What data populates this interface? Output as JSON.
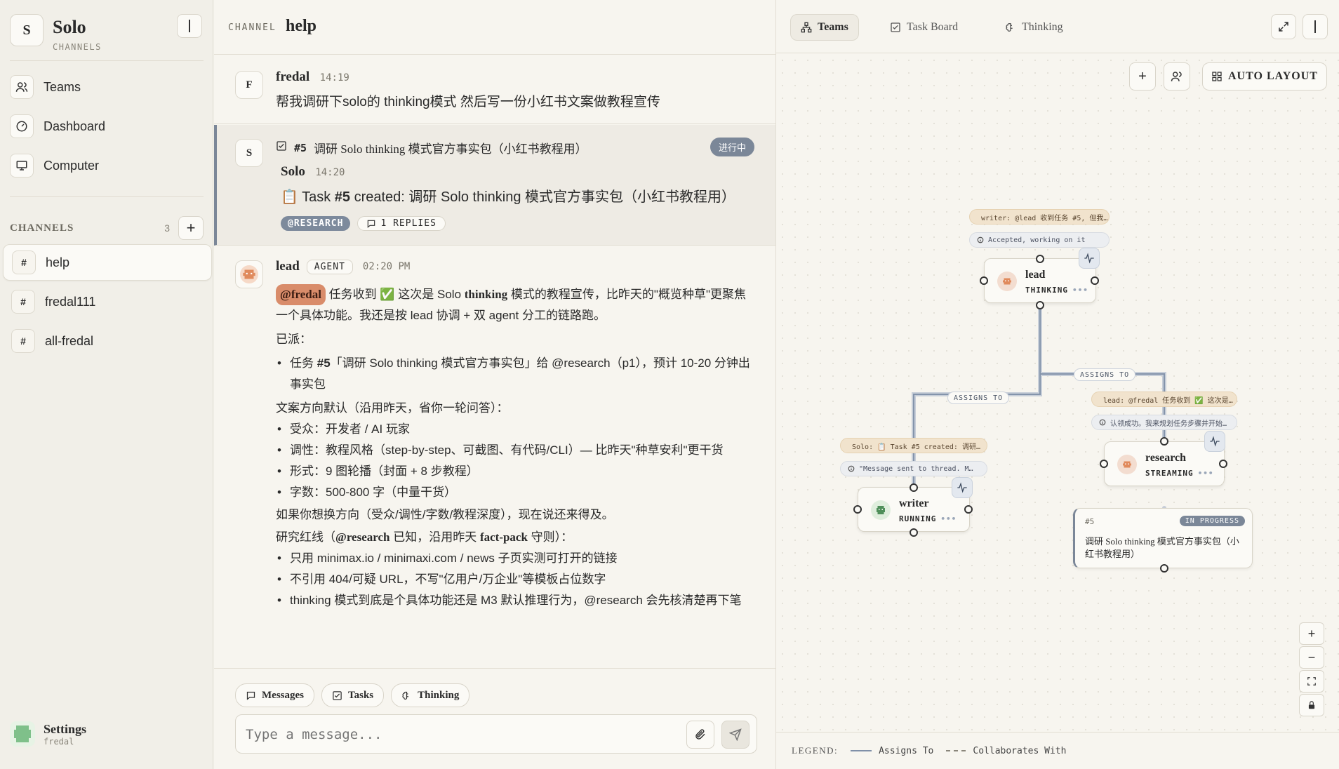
{
  "app": {
    "logo_letter": "S",
    "title": "Solo",
    "subtitle": "CHANNELS"
  },
  "sidebar": {
    "nav": [
      {
        "label": "Teams",
        "icon": "users-icon"
      },
      {
        "label": "Dashboard",
        "icon": "gauge-icon"
      },
      {
        "label": "Computer",
        "icon": "monitor-icon"
      }
    ],
    "channels_label": "CHANNELS",
    "channels_count": "3",
    "channels": [
      {
        "name": "help",
        "active": true
      },
      {
        "name": "fredal111",
        "active": false
      },
      {
        "name": "all-fredal",
        "active": false
      }
    ],
    "settings_label": "Settings",
    "settings_user": "fredal"
  },
  "channel": {
    "kind": "CHANNEL",
    "name": "help"
  },
  "messages": {
    "m1": {
      "avatar": "F",
      "author": "fredal",
      "time": "14:19",
      "text": "帮我调研下solo的 thinking模式 然后写一份小红书文案做教程宣传"
    },
    "m2": {
      "avatar": "S",
      "task_ref": "#5",
      "task_title": "调研 Solo thinking 模式官方事实包（小红书教程用）",
      "status": "进行中",
      "author": "Solo",
      "time": "14:20",
      "text_prefix": "📋 Task ",
      "text_id": "#5",
      "text_rest": " created: 调研 Solo thinking 模式官方事实包（小红书教程用）",
      "tag": "@RESEARCH",
      "replies": "1 REPLIES"
    },
    "m3": {
      "author": "lead",
      "badge": "AGENT",
      "time": "02:20 PM",
      "mention": "@fredal",
      "intro_a": " 任务收到 ✅ 这次是 Solo ",
      "intro_bold": "thinking",
      "intro_b": " 模式的教程宣传，比昨天的\"概览种草\"更聚焦一个具体功能。我还是按 lead 协调 + 双 agent 分工的链路跑。",
      "dispatched": "已派：",
      "dispatch_a": "任务 ",
      "dispatch_id": "#5",
      "dispatch_b": "「调研 Solo thinking 模式官方事实包」给 @research（p1），预计 10-20 分钟出事实包",
      "direction": "文案方向默认（沿用昨天，省你一轮问答）：",
      "bullets": [
        "受众：开发者 / AI 玩家",
        "调性：教程风格（step-by-step、可截图、有代码/CLI）— 比昨天\"种草安利\"更干货",
        "形式：9 图轮播（封面 + 8 步教程）",
        "字数：500-800 字（中量干货）"
      ],
      "change_note": "如果你想换方向（受众/调性/字数/教程深度），现在说还来得及。",
      "redline_a": "研究红线（",
      "redline_bold1": "@research",
      "redline_b": " 已知，沿用昨天 ",
      "redline_bold2": "fact-pack",
      "redline_c": " 守则）：",
      "redlines": [
        "只用 minimax.io / minimaxi.com / news 子页实测可打开的链接",
        "不引用 404/可疑 URL，不写\"亿用户/万企业\"等模板占位数字",
        "thinking 模式到底是个具体功能还是 M3 默认推理行为，@research 会先核清楚再下笔"
      ]
    }
  },
  "composer": {
    "tabs": [
      "Messages",
      "Tasks",
      "Thinking"
    ],
    "placeholder": "Type a message..."
  },
  "right_panel": {
    "tabs": [
      "Teams",
      "Task Board",
      "Thinking"
    ],
    "auto_layout": "AUTO LAYOUT",
    "nodes": {
      "lead": {
        "name": "lead",
        "status": "THINKING",
        "dots": "•••"
      },
      "writer": {
        "name": "writer",
        "status": "RUNNING",
        "dots": "•••"
      },
      "research": {
        "name": "research",
        "status": "STREAMING",
        "dots": "•••"
      }
    },
    "bubbles": {
      "lead_msg": "writer: @lead 收到任务 #5, 但我…",
      "lead_info": "Accepted, working on it",
      "writer_msg": "Solo: 📋 Task #5 created: 调研…",
      "writer_info": "\"Message sent to thread. M…",
      "research_msg": "lead: @fredal 任务收到 ✅ 这次是…",
      "research_info": "认领成功。我来规划任务步骤并开始…"
    },
    "edge_labels": [
      "ASSIGNS TO",
      "ASSIGNS TO"
    ],
    "task": {
      "id": "#5",
      "status": "IN PROGRESS",
      "title": "调研 Solo thinking 模式官方事实包（小红书教程用）"
    },
    "legend": {
      "label": "LEGEND:",
      "assigns": "Assigns To",
      "collab": "Collaborates With"
    }
  },
  "colors": {
    "accent_slate": "#7b8798",
    "mention_bg": "#d98c6a",
    "bg": "#f3f1ea"
  }
}
